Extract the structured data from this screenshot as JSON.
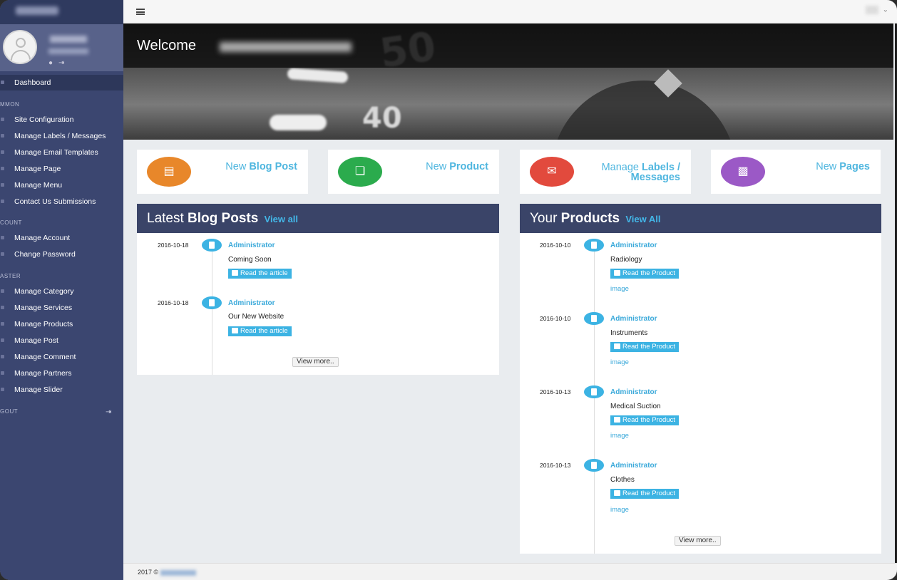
{
  "sidebar": {
    "items": [
      {
        "label": "Dashboard"
      },
      {
        "label": "Site Configuration"
      },
      {
        "label": "Manage Labels / Messages"
      },
      {
        "label": "Manage Email Templates"
      },
      {
        "label": "Manage Page"
      },
      {
        "label": "Manage Menu"
      },
      {
        "label": "Contact Us Submissions"
      },
      {
        "label": "Manage Account"
      },
      {
        "label": "Change Password"
      },
      {
        "label": "Manage Category"
      },
      {
        "label": "Manage Services"
      },
      {
        "label": "Manage Products"
      },
      {
        "label": "Manage Post"
      },
      {
        "label": "Manage Comment"
      },
      {
        "label": "Manage Partners"
      },
      {
        "label": "Manage Slider"
      }
    ],
    "sections": {
      "common": "MMON",
      "account": "COUNT",
      "master": "ASTER",
      "logout": "GOUT"
    }
  },
  "hero": {
    "welcome": "Welcome"
  },
  "tiles": [
    {
      "light": "New",
      "bold": "Blog Post",
      "color": "#e8872a",
      "icon": "document-icon"
    },
    {
      "light": "New",
      "bold": "Product",
      "color": "#2bab4d",
      "icon": "gift-icon"
    },
    {
      "light": "Manage",
      "bold": "Labels /",
      "bold2": "Messages",
      "color": "#e24a3d",
      "icon": "envelope-icon"
    },
    {
      "light": "New",
      "bold": "Pages",
      "color": "#9b59c6",
      "icon": "contact-card-icon"
    }
  ],
  "blog": {
    "title_light": "Latest",
    "title_bold": "Blog Posts",
    "view_all": "View all",
    "posts": [
      {
        "date": "2016-10-18",
        "author": "Administrator",
        "title": "Coming Soon",
        "button": "Read the article"
      },
      {
        "date": "2016-10-18",
        "author": "Administrator",
        "title": "Our New Website",
        "button": "Read the article"
      }
    ],
    "view_more": "View more.."
  },
  "products": {
    "title_light": "Your",
    "title_bold": "Products",
    "view_all": "View All",
    "items": [
      {
        "date": "2016-10-10",
        "author": "Administrator",
        "title": "Radiology",
        "button": "Read the Product",
        "image": "image"
      },
      {
        "date": "2016-10-10",
        "author": "Administrator",
        "title": "Instruments",
        "button": "Read the Product",
        "image": "image"
      },
      {
        "date": "2016-10-13",
        "author": "Administrator",
        "title": "Medical Suction",
        "button": "Read the Product",
        "image": "image"
      },
      {
        "date": "2016-10-13",
        "author": "Administrator",
        "title": "Clothes",
        "button": "Read the Product",
        "image": "image"
      }
    ],
    "view_more": "View more.."
  },
  "footer": {
    "copyright": "2017 ©"
  }
}
